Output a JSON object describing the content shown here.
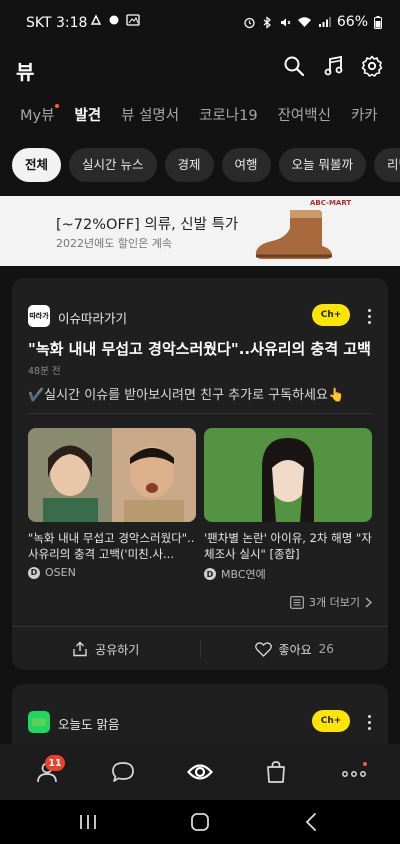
{
  "status_bar": {
    "carrier_time": "SKT 3:18",
    "battery": "66%"
  },
  "app": {
    "title": "뷰"
  },
  "tabs": [
    {
      "label": "My뷰",
      "new_dot": true
    },
    {
      "label": "발견",
      "active": true
    },
    {
      "label": "뷰 설명서"
    },
    {
      "label": "코로나19"
    },
    {
      "label": "잔여백신"
    },
    {
      "label": "카카"
    }
  ],
  "chips": [
    {
      "label": "전체",
      "active": true
    },
    {
      "label": "실시간 뉴스"
    },
    {
      "label": "경제"
    },
    {
      "label": "여행"
    },
    {
      "label": "오늘 뭐볼까"
    },
    {
      "label": "리빙"
    }
  ],
  "ad": {
    "title": "[~72%OFF] 의류, 신발 특가",
    "subtitle": "2022년에도 할인은 계속",
    "brand": "ABC-MART"
  },
  "card": {
    "channel": "이슈따라가기",
    "channel_logo_text": "따라가",
    "ch_badge": "Ch+",
    "headline": "\"녹화 내내 무섭고 경악스러웠다\"..사유리의 충격 고백",
    "time": "48분 전",
    "promo": "✔️실시간 이슈를 받아보시려면 친구 추가로 구독하세요👆",
    "articles": [
      {
        "caption": "\"녹화 내내 무섭고 경악스러웠다\"..사유리의 충격 고백('미친.사...",
        "source": "OSEN",
        "source_icon": "D"
      },
      {
        "caption": "'팬차별 논란' 아이유, 2차 해명 \"자체조사 실시\" [종합]",
        "source": "MBC연예",
        "source_icon": "D"
      }
    ],
    "more": "3개 더보기",
    "share": "공유하기",
    "like": "좋아요",
    "like_count": "26"
  },
  "card2": {
    "channel": "오늘도 맑음",
    "ch_badge": "Ch+"
  },
  "bottom_nav": {
    "items": [
      {
        "icon": "person-icon",
        "badge": "11"
      },
      {
        "icon": "chat-bubble-icon"
      },
      {
        "icon": "view-eye-icon",
        "active": true
      },
      {
        "icon": "shopping-bag-icon"
      },
      {
        "icon": "more-dots-icon",
        "new_dot": true
      }
    ]
  },
  "colors": {
    "background": "#121212",
    "card": "#1f1f1f",
    "kakao_yellow": "#fee500",
    "badge_red": "#e8412c"
  }
}
